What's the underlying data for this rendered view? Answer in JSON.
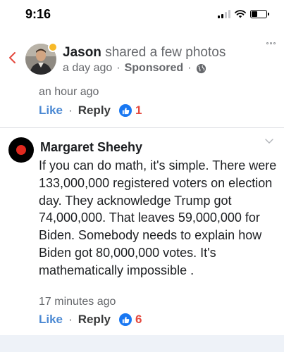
{
  "status_bar": {
    "time": "9:16"
  },
  "header": {
    "author": "Jason",
    "action": "shared a few photos",
    "time": "a day ago",
    "sep1": "·",
    "sponsored": "Sponsored",
    "sep2": "·"
  },
  "comments": [
    {
      "time": "an hour ago",
      "like_label": "Like",
      "sep": "·",
      "reply_label": "Reply",
      "reaction_count": "1"
    },
    {
      "author": "Margaret Sheehy",
      "text": "If you can do math, it's simple. There were 133,000,000 registered voters on election day. They acknowledge Trump got 74,000,000. That leaves 59,000,000 for Biden. Somebody needs to explain how Biden got 80,000,000 votes. It's mathematically impossible .",
      "time": "17 minutes ago",
      "like_label": "Like",
      "sep": "·",
      "reply_label": "Reply",
      "reaction_count": "6"
    }
  ],
  "colors": {
    "like_blue": "#4b89d3",
    "reaction_badge": "#1877f2",
    "count_red": "#e4483d",
    "back_chevron": "#e4483d"
  }
}
